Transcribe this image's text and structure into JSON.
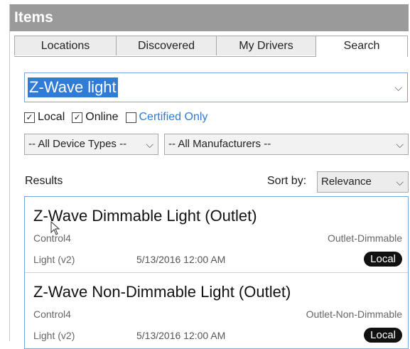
{
  "panel": {
    "title": "Items"
  },
  "tabs": [
    {
      "label": "Locations",
      "active": false
    },
    {
      "label": "Discovered",
      "active": false
    },
    {
      "label": "My Drivers",
      "active": false
    },
    {
      "label": "Search",
      "active": true
    }
  ],
  "search": {
    "value": "Z-Wave light"
  },
  "filters": {
    "local": {
      "label": "Local",
      "checked": true
    },
    "online": {
      "label": "Online",
      "checked": true
    },
    "certified": {
      "label": "Certified Only",
      "checked": false
    }
  },
  "device_types": {
    "selected": "-- All Device Types --"
  },
  "manufacturers": {
    "selected": "-- All Manufacturers --"
  },
  "results": {
    "label": "Results",
    "sort_label": "Sort by:",
    "sort_value": "Relevance",
    "items": [
      {
        "title": "Z-Wave Dimmable Light (Outlet)",
        "manufacturer": "Control4",
        "type": "Outlet-Dimmable",
        "version": "Light (v2)",
        "date": "5/13/2016 12:00 AM",
        "badge": "Local"
      },
      {
        "title": "Z-Wave Non-Dimmable Light (Outlet)",
        "manufacturer": "Control4",
        "type": "Outlet-Non-Dimmable",
        "version": "Light (v2)",
        "date": "5/13/2016 12:00 AM",
        "badge": "Local"
      }
    ]
  },
  "icons": {
    "chevron": "chevron-down-icon",
    "checkmark": "checkmark-icon",
    "cursor": "mouse-cursor-icon"
  },
  "colors": {
    "title_bar": "#9a9a9a",
    "selection": "#2f7bd6",
    "badge": "#111111",
    "link": "#2f7bd6"
  }
}
